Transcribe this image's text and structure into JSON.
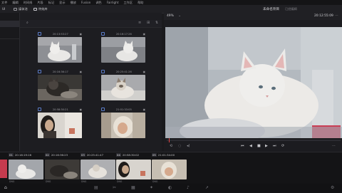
{
  "menubar": {
    "items": [
      "文件",
      "编辑",
      "时间线",
      "片段",
      "标记",
      "显示",
      "播放",
      "Fusion",
      "调色",
      "Fairlight",
      "工作区",
      "帮助"
    ]
  },
  "toolbar": {
    "left_label": "UI",
    "media_pool_label": "媒体池",
    "effects_label": "特效库",
    "project_name": "未命名项目",
    "edited_label": "已经编辑"
  },
  "viewer": {
    "zoom": "49%",
    "timecode": "20:12:55:09",
    "frame_caption": ""
  },
  "bin_cards": [
    {
      "timecode": "20:13:53:27",
      "kind": "cat-white-1"
    },
    {
      "timecode": "20:16:17:26",
      "kind": "cat-white-2"
    },
    {
      "timecode": "20:16:36:17",
      "kind": "cat-dark-1"
    },
    {
      "timecode": "20:25:41:26",
      "kind": "cat-siamese"
    },
    {
      "timecode": "20:58:30:21",
      "kind": "person"
    },
    {
      "timecode": "21:01:33:05",
      "kind": "hands"
    }
  ],
  "clips": [
    {
      "num": "01",
      "timecode": "20:16:19:16",
      "format": "DNG"
    },
    {
      "num": "02",
      "timecode": "20:16:36:23",
      "format": "DNG"
    },
    {
      "num": "03",
      "timecode": "20:25:41:47",
      "format": "DNG"
    },
    {
      "num": "04",
      "timecode": "20:58:30:02",
      "format": "DNG"
    },
    {
      "num": "05",
      "timecode": "21:01:34:00",
      "format": "DNG"
    }
  ],
  "colors": {
    "accent": "#5b7cc8",
    "panel": "#1d1d21",
    "viewer_bg": "#0c0c0e"
  }
}
